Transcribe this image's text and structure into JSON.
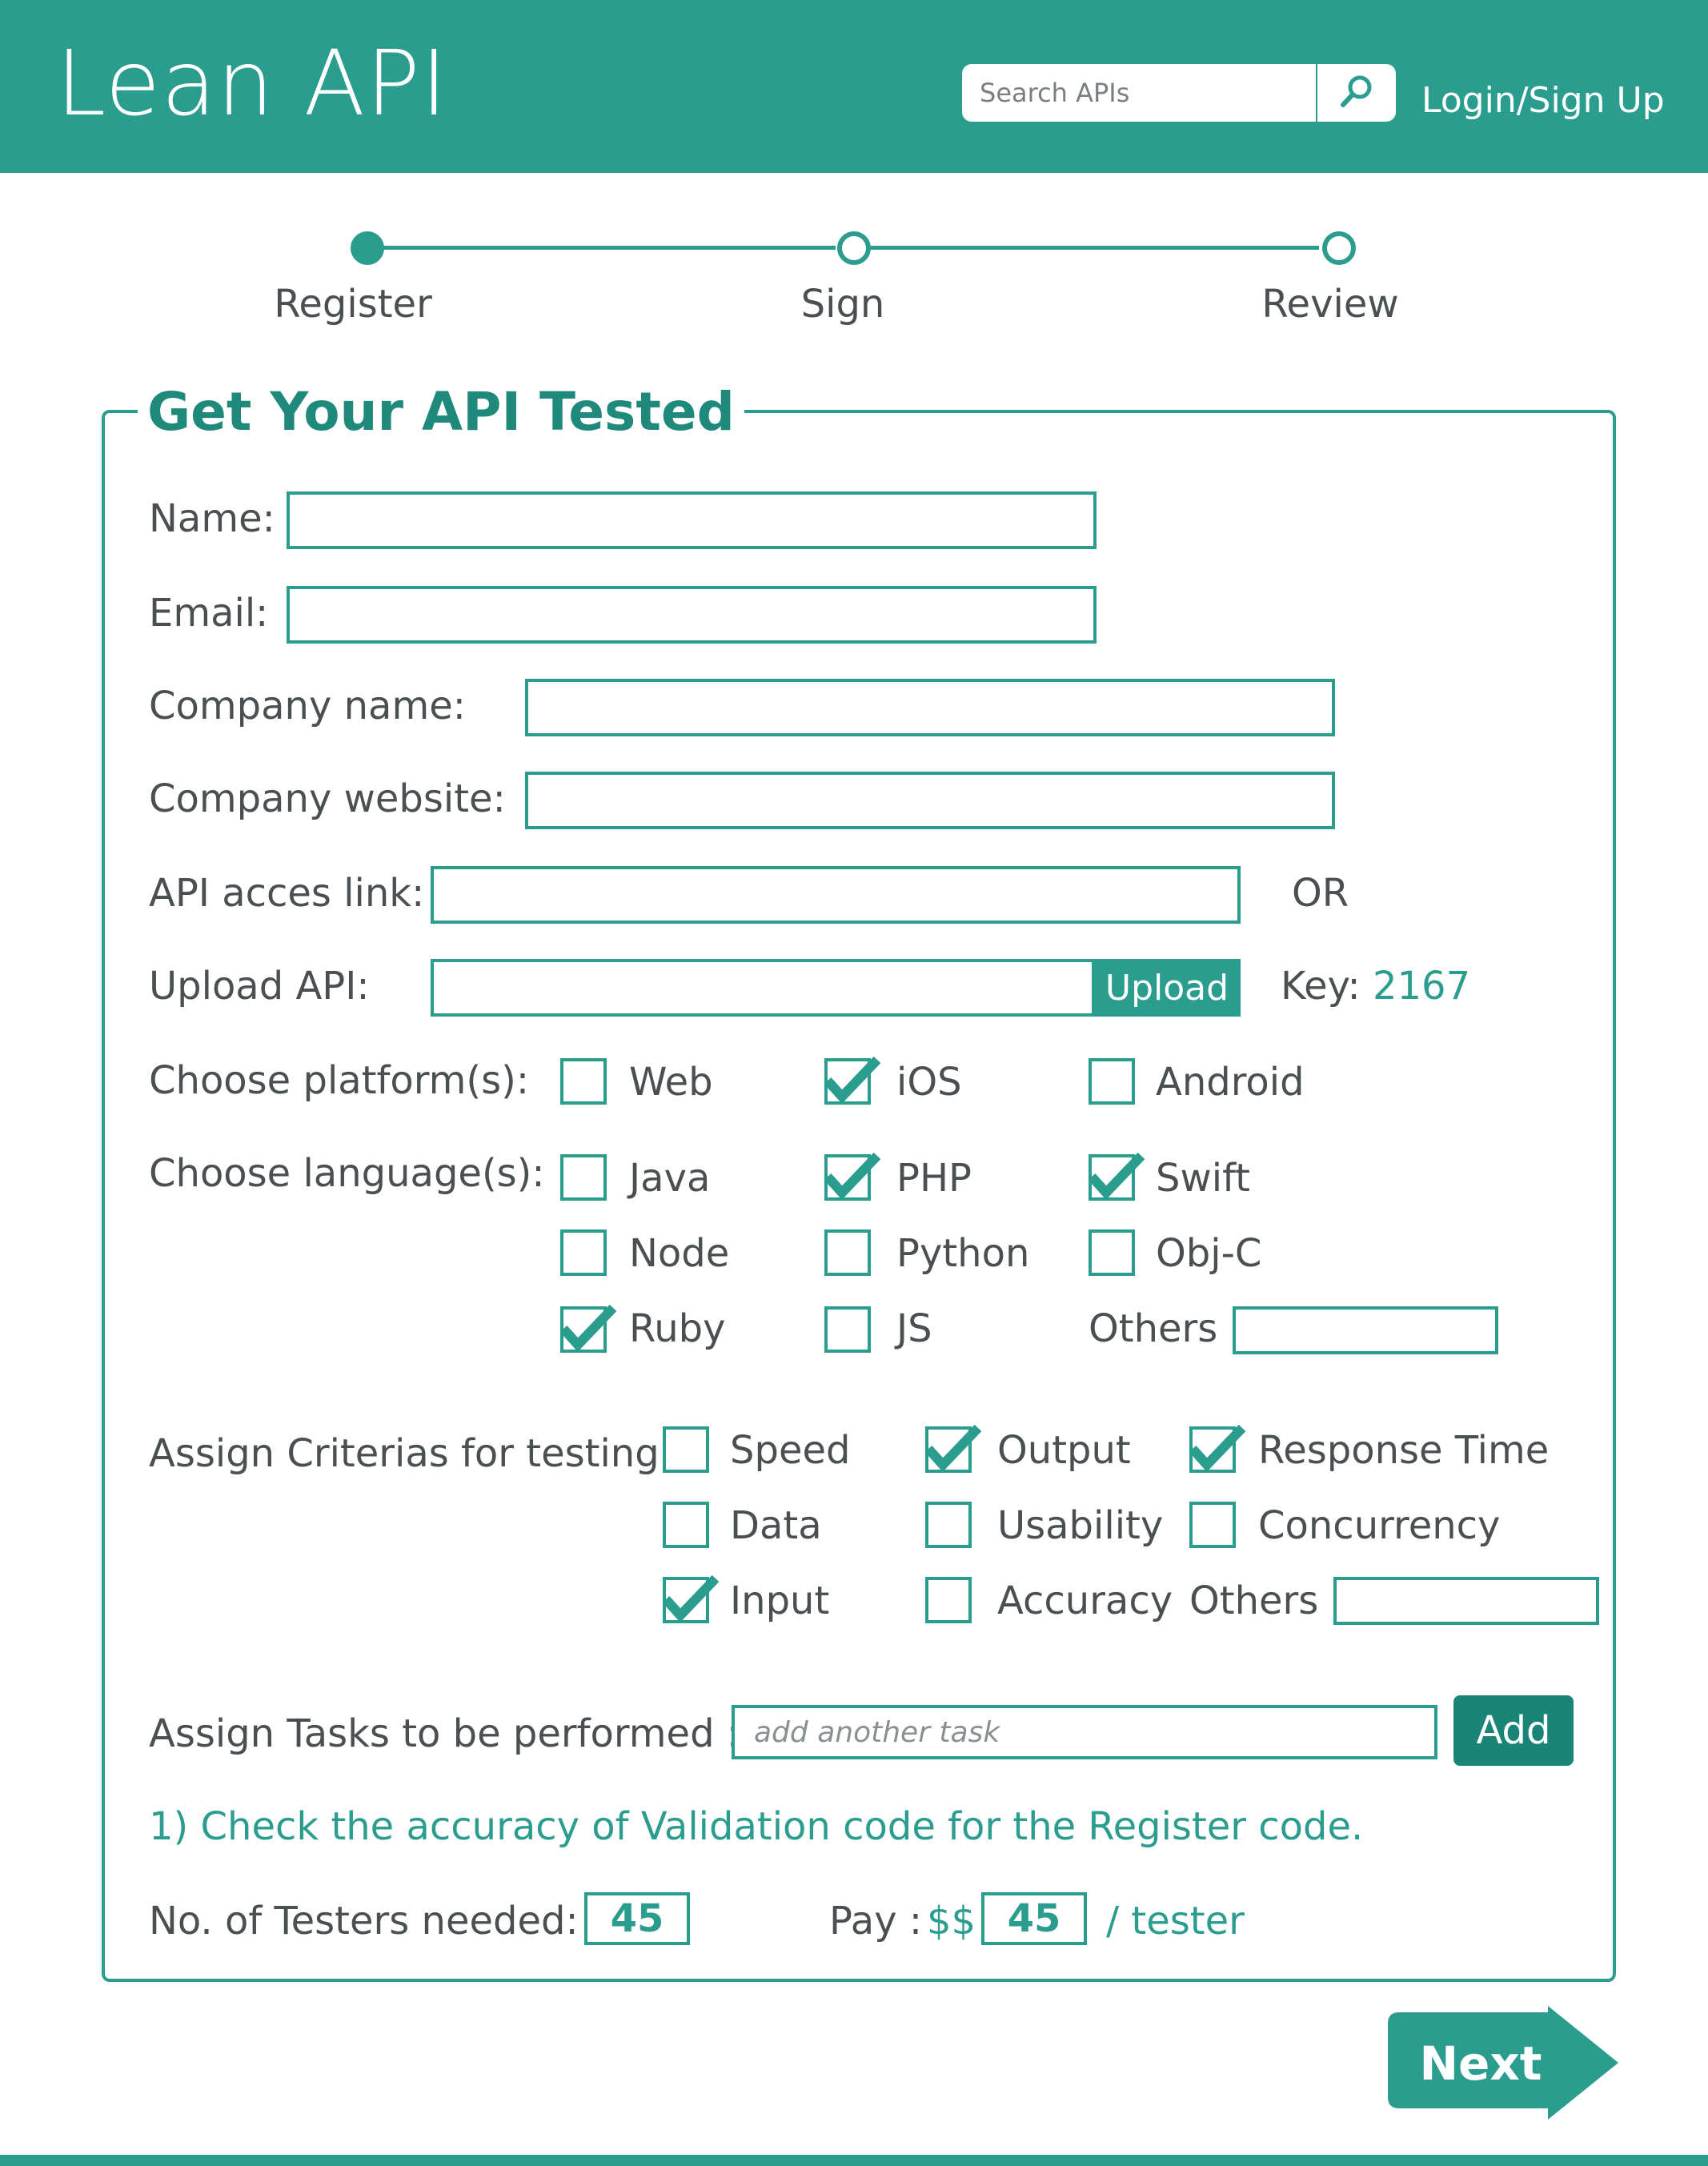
{
  "colors": {
    "primary": "#2a9d8f",
    "primary_dark": "#1a8577",
    "text": "#4a4f52",
    "background": "#ffffff"
  },
  "header": {
    "brand": "Lean API",
    "search_placeholder": "Search APIs",
    "search_icon": "search-icon",
    "login_label": "Login/Sign Up"
  },
  "stepper": {
    "steps": [
      {
        "label": "Register",
        "active": true
      },
      {
        "label": "Sign",
        "active": false
      },
      {
        "label": "Review",
        "active": false
      }
    ]
  },
  "form": {
    "title": "Get Your API Tested",
    "fields": {
      "name_label": "Name:",
      "email_label": "Email:",
      "company_name_label": "Company name:",
      "company_website_label": "Company website:",
      "api_link_label": "API acces link:",
      "or_label": "OR",
      "upload_label": "Upload API:",
      "upload_button": "Upload",
      "key_label": "Key:",
      "key_value": "2167"
    },
    "platforms": {
      "label": "Choose platform(s):",
      "options": [
        {
          "label": "Web",
          "checked": false
        },
        {
          "label": "iOS",
          "checked": true
        },
        {
          "label": "Android",
          "checked": false
        }
      ]
    },
    "languages": {
      "label": "Choose language(s):",
      "options": [
        {
          "label": "Java",
          "checked": false
        },
        {
          "label": "PHP",
          "checked": true
        },
        {
          "label": "Swift",
          "checked": true
        },
        {
          "label": "Node",
          "checked": false
        },
        {
          "label": "Python",
          "checked": false
        },
        {
          "label": "Obj-C",
          "checked": false
        },
        {
          "label": "Ruby",
          "checked": true
        },
        {
          "label": "JS",
          "checked": false
        }
      ],
      "others_label": "Others"
    },
    "criteria": {
      "label": "Assign Criterias for testing:",
      "options": [
        {
          "label": "Speed",
          "checked": false
        },
        {
          "label": "Output",
          "checked": true
        },
        {
          "label": "Response Time",
          "checked": true
        },
        {
          "label": "Data",
          "checked": false
        },
        {
          "label": "Usability",
          "checked": false
        },
        {
          "label": "Concurrency",
          "checked": false
        },
        {
          "label": "Input",
          "checked": true
        },
        {
          "label": "Accuracy",
          "checked": false
        }
      ],
      "others_label": "Others"
    },
    "tasks": {
      "label": "Assign Tasks to be performed :",
      "placeholder": "add another task",
      "add_button": "Add",
      "items": [
        "1) Check the accuracy of Validation code for the Register code."
      ]
    },
    "testers": {
      "label": "No. of Testers needed:",
      "value": "45",
      "pay_label": "Pay :",
      "currency": "$$",
      "pay_value": "45",
      "per_label": "/ tester"
    }
  },
  "next_button": "Next"
}
